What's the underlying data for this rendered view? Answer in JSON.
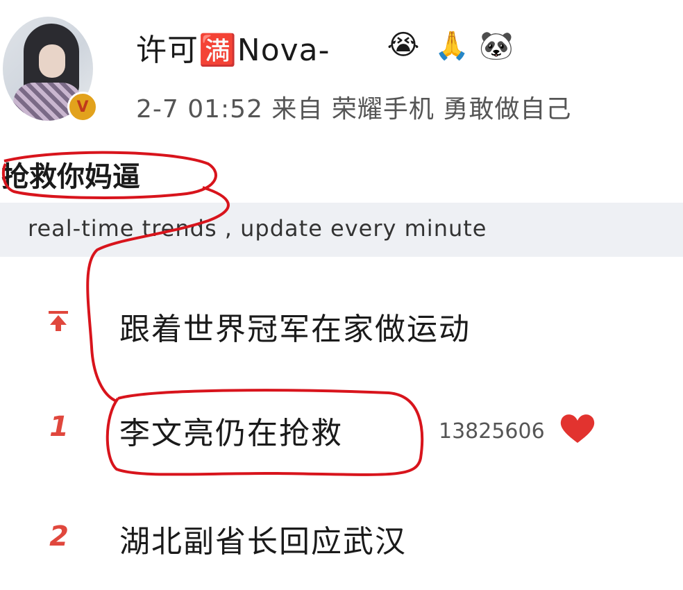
{
  "post": {
    "username": "许可🈵Nova-",
    "meta": "2-7 01:52  来自 荣耀手机 勇敢做自己",
    "text": "抢救你妈逼"
  },
  "icons": {
    "avatar": "avatar-photo",
    "verified": "verified-v-badge",
    "emojis": [
      "crying-face-emoji",
      "praying-hands-emoji",
      "panda-face-emoji"
    ]
  },
  "trends": {
    "header": "real-time trends , update every minute",
    "items": [
      {
        "rank": "",
        "rank_icon": "pinned-top-icon",
        "title": "跟着世界冠军在家做运动",
        "count": ""
      },
      {
        "rank": "1",
        "title": "李文亮仍在抢救",
        "count": "13825606",
        "badge_icon": "heart-icon"
      },
      {
        "rank": "2",
        "title": "湖北副省长回应武汉",
        "count": ""
      }
    ]
  },
  "colors": {
    "rank": "#e0473d",
    "annotation": "#d8141c",
    "header_bg": "#eef0f4",
    "heart": "#e2332f"
  }
}
